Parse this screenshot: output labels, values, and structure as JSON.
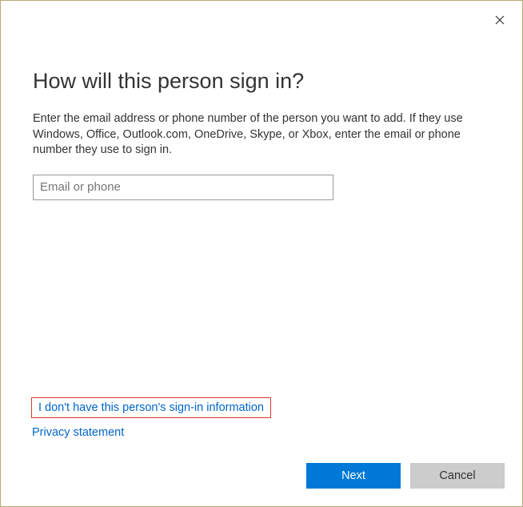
{
  "heading": "How will this person sign in?",
  "description": "Enter the email address or phone number of the person you want to add. If they use Windows, Office, Outlook.com, OneDrive, Skype, or Xbox, enter the email or phone number they use to sign in.",
  "input": {
    "placeholder": "Email or phone",
    "value": ""
  },
  "links": {
    "no_info": "I don't have this person's sign-in information",
    "privacy": "Privacy statement"
  },
  "buttons": {
    "next": "Next",
    "cancel": "Cancel"
  }
}
